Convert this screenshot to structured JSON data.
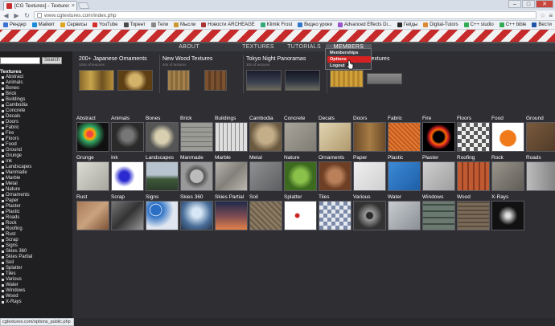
{
  "browser": {
    "tab_title": "[CG Textures] - Textures f",
    "tab_close": "×",
    "url": "www.cgtextures.com/index.php",
    "win_min": "–",
    "win_max": "□",
    "win_close": "✕"
  },
  "bookmarks": [
    {
      "label": "Рендер",
      "color": "#3b6fd0"
    },
    {
      "label": "Майкит",
      "color": "#1a8bd8"
    },
    {
      "label": "Сервисы",
      "color": "#e2a51f"
    },
    {
      "label": "YouTube",
      "color": "#d62d2d"
    },
    {
      "label": "Торент",
      "color": "#4a4a4a"
    },
    {
      "label": "Тепи",
      "color": "#888"
    },
    {
      "label": "Мысли",
      "color": "#c93"
    },
    {
      "label": "Новости ARCHEAGE",
      "color": "#a33"
    },
    {
      "label": "Klimik Frost",
      "color": "#3a7"
    },
    {
      "label": "Видео уроки",
      "color": "#37c"
    },
    {
      "label": "Advanced Effects Di...",
      "color": "#95c"
    },
    {
      "label": "Гейды",
      "color": "#2a2a2a"
    },
    {
      "label": "Digital-Tutors",
      "color": "#d83"
    },
    {
      "label": "C++ studio",
      "color": "#3a5"
    },
    {
      "label": "C++ bible",
      "color": "#3a5"
    },
    {
      "label": "Вести",
      "color": "#25a"
    }
  ],
  "nav": {
    "about": "ABOUT",
    "textures": "TEXTURES",
    "tutorials": "TUTORIALS",
    "members": "MEMBERS"
  },
  "dropdown": {
    "memberships": "Memberships",
    "options": "Options",
    "logout": "Logout"
  },
  "sidebar": {
    "search_placeholder": "",
    "search_button": "Search",
    "heading": "Textures",
    "items": [
      "Abstract",
      "Animals",
      "Bones",
      "Brick",
      "Buildings",
      "Cambodia",
      "Concrete",
      "Decals",
      "Doors",
      "Fabric",
      "Fire",
      "Floors",
      "Food",
      "Ground",
      "Grunge",
      "Ink",
      "Landscapes",
      "Manmade",
      "Marble",
      "Metal",
      "Nature",
      "Ornaments",
      "Paper",
      "Plaster",
      "Plastic",
      "Roads",
      "Rock",
      "Roofing",
      "Rust",
      "Scrap",
      "Signs",
      "Skies 360",
      "Skies Partial",
      "Soil",
      "Splatter",
      "Tiles",
      "Various",
      "Water",
      "Windows",
      "Wood",
      "X-Rays"
    ]
  },
  "features": [
    {
      "title": "200+ Japanese Ornaments",
      "sub": "100s of textures"
    },
    {
      "title": "New Wood Textures",
      "sub": "40s of textures"
    },
    {
      "title": "Tokyo Night Panoramas",
      "sub": "30s of textures"
    },
    {
      "title": "Textures",
      "sub": ""
    }
  ],
  "grid": [
    [
      "Abstract",
      "Animals",
      "Bones",
      "Brick",
      "Buildings",
      "Cambodia",
      "Concrete",
      "Decals",
      "Doors",
      "Fabric",
      "Fire",
      "Floors",
      "Food",
      "Ground"
    ],
    [
      "Grunge",
      "Ink",
      "Landscapes",
      "Manmade",
      "Marble",
      "Metal",
      "Nature",
      "Ornaments",
      "Paper",
      "Plastic",
      "Plaster",
      "Roofing",
      "Rock",
      "Roads"
    ],
    [
      "Rust",
      "Scrap",
      "Signs",
      "Skies 360",
      "Skies Partial",
      "Soil",
      "Splatter",
      "Tiles",
      "Various",
      "Water",
      "Windows",
      "Wood",
      "X-Rays"
    ]
  ],
  "status_url": "cgtextures.com/options_public.php"
}
